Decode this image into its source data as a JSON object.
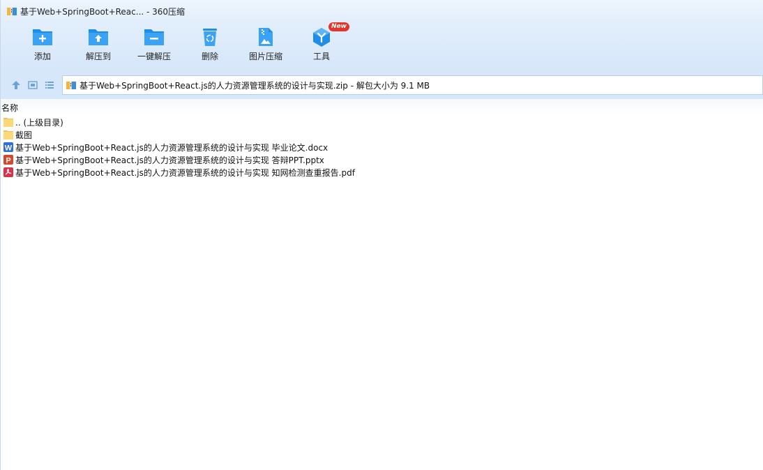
{
  "window": {
    "title": "基于Web+SpringBoot+Reac... - 360压缩"
  },
  "toolbar": {
    "items": [
      {
        "label": "添加",
        "icon": "folder-add-icon"
      },
      {
        "label": "解压到",
        "icon": "folder-extract-icon"
      },
      {
        "label": "一键解压",
        "icon": "one-click-extract-icon"
      },
      {
        "label": "删除",
        "icon": "trash-icon"
      },
      {
        "label": "图片压缩",
        "icon": "image-compress-icon"
      },
      {
        "label": "工具",
        "icon": "tools-icon",
        "badge": "New"
      }
    ]
  },
  "address": {
    "path": "基于Web+SpringBoot+React.js的人力资源管理系统的设计与实现.zip - 解包大小为 9.1 MB"
  },
  "list": {
    "column_name": "名称",
    "rows": [
      {
        "name": ".. (上级目录)",
        "type": "folder"
      },
      {
        "name": "截图",
        "type": "folder"
      },
      {
        "name": "基于Web+SpringBoot+React.js的人力资源管理系统的设计与实现 毕业论文.docx",
        "type": "docx"
      },
      {
        "name": "基于Web+SpringBoot+React.js的人力资源管理系统的设计与实现 答辩PPT.pptx",
        "type": "pptx"
      },
      {
        "name": "基于Web+SpringBoot+React.js的人力资源管理系统的设计与实现 知网检测查重报告.pdf",
        "type": "pdf"
      }
    ]
  },
  "colors": {
    "accent_blue": "#1e8ee8",
    "toolbar_bg": "#d6e7fa",
    "badge_red": "#e5352b"
  }
}
